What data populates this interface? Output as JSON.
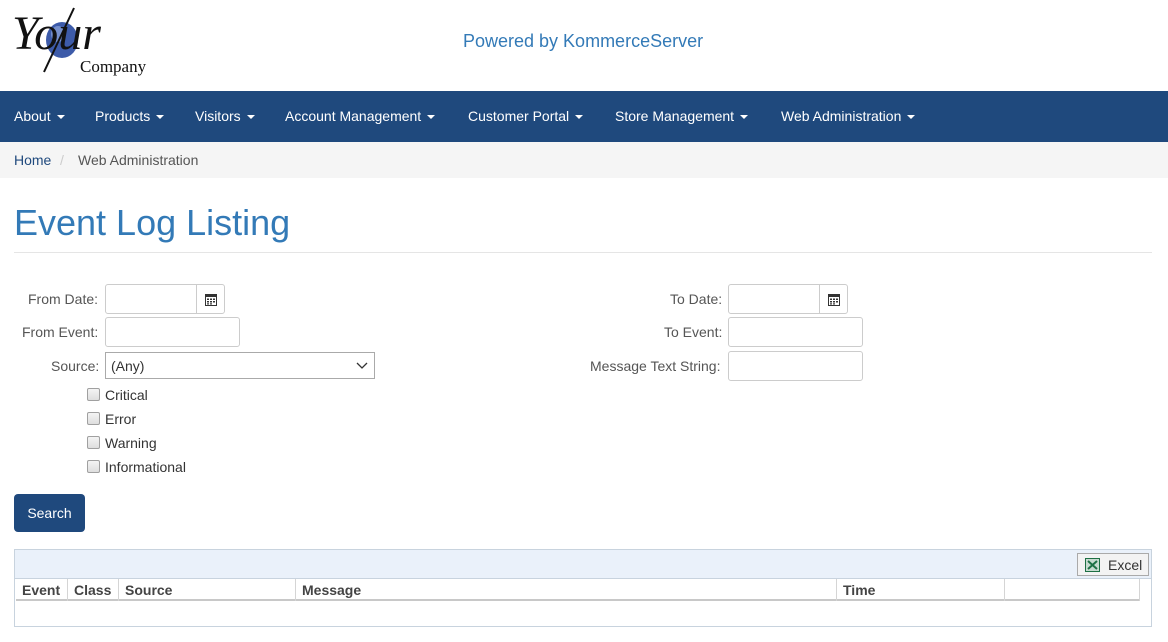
{
  "header": {
    "logo_text": "Your",
    "logo_subtext": "Company",
    "powered_by": "Powered by KommerceServer"
  },
  "nav": {
    "items": [
      {
        "label": "About"
      },
      {
        "label": "Products"
      },
      {
        "label": "Visitors"
      },
      {
        "label": "Account Management"
      },
      {
        "label": "Customer Portal"
      },
      {
        "label": "Store Management"
      },
      {
        "label": "Web Administration"
      }
    ]
  },
  "breadcrumb": {
    "home": "Home",
    "separator": "/",
    "current": "Web Administration"
  },
  "page": {
    "title": "Event Log Listing"
  },
  "form": {
    "from_date_label": "From Date:",
    "to_date_label": "To Date:",
    "from_event_label": "From Event:",
    "to_event_label": "To Event:",
    "source_label": "Source:",
    "source_value": "(Any)",
    "message_label": "Message Text String:",
    "from_date_value": "",
    "to_date_value": "",
    "from_event_value": "",
    "to_event_value": "",
    "message_value": "",
    "checkboxes": [
      {
        "label": "Critical",
        "checked": false
      },
      {
        "label": "Error",
        "checked": false
      },
      {
        "label": "Warning",
        "checked": false
      },
      {
        "label": "Informational",
        "checked": false
      }
    ],
    "search_label": "Search"
  },
  "grid": {
    "export_label": "Excel",
    "columns": [
      "Event",
      "Class",
      "Source",
      "Message",
      "Time",
      ""
    ]
  },
  "colors": {
    "navbar": "#1f497d",
    "accent": "#337ab7"
  }
}
